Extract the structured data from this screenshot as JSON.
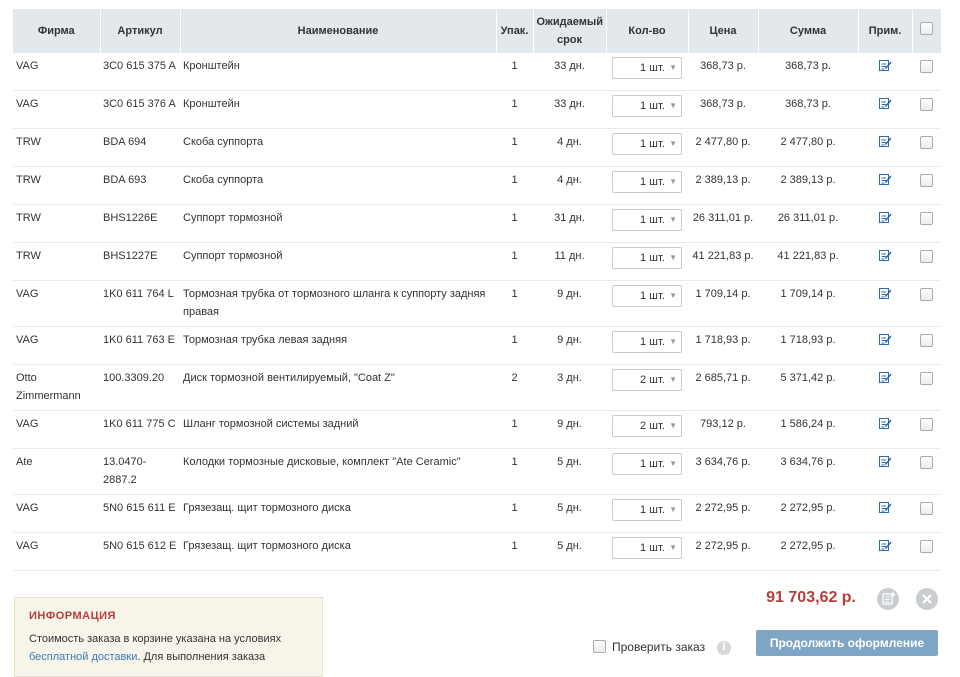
{
  "columns": {
    "firm": "Фирма",
    "article": "Артикул",
    "name": "Наименование",
    "pack": "Упак.",
    "term_line1": "Ожидаемый",
    "term_line2": "срок",
    "qty": "Кол-во",
    "price": "Цена",
    "sum": "Сумма",
    "note": "Прим."
  },
  "rows": [
    {
      "firm": "VAG",
      "article": "3C0 615 375 A",
      "name": "Кронштейн",
      "pack": "1",
      "term": "33 дн.",
      "qty": "1 шт.",
      "price": "368,73 р.",
      "sum": "368,73 р."
    },
    {
      "firm": "VAG",
      "article": "3C0 615 376 A",
      "name": "Кронштейн",
      "pack": "1",
      "term": "33 дн.",
      "qty": "1 шт.",
      "price": "368,73 р.",
      "sum": "368,73 р."
    },
    {
      "firm": "TRW",
      "article": "BDA 694",
      "name": "Скоба суппорта",
      "pack": "1",
      "term": "4 дн.",
      "qty": "1 шт.",
      "price": "2 477,80 р.",
      "sum": "2 477,80 р."
    },
    {
      "firm": "TRW",
      "article": "BDA 693",
      "name": "Скоба суппорта",
      "pack": "1",
      "term": "4 дн.",
      "qty": "1 шт.",
      "price": "2 389,13 р.",
      "sum": "2 389,13 р."
    },
    {
      "firm": "TRW",
      "article": "BHS1226E",
      "name": "Суппорт тормозной",
      "pack": "1",
      "term": "31 дн.",
      "qty": "1 шт.",
      "price": "26 311,01 р.",
      "sum": "26 311,01 р."
    },
    {
      "firm": "TRW",
      "article": "BHS1227E",
      "name": "Суппорт тормозной",
      "pack": "1",
      "term": "11 дн.",
      "qty": "1 шт.",
      "price": "41 221,83 р.",
      "sum": "41 221,83 р."
    },
    {
      "firm": "VAG",
      "article": "1K0 611 764 L",
      "name": "Тормозная трубка от тормозного шланга к суппорту задняя правая",
      "pack": "1",
      "term": "9 дн.",
      "qty": "1 шт.",
      "price": "1 709,14 р.",
      "sum": "1 709,14 р."
    },
    {
      "firm": "VAG",
      "article": "1K0 611 763 E",
      "name": "Тормозная трубка левая задняя",
      "pack": "1",
      "term": "9 дн.",
      "qty": "1 шт.",
      "price": "1 718,93 р.",
      "sum": "1 718,93 р."
    },
    {
      "firm": "Otto Zimmermann",
      "article": "100.3309.20",
      "name": "Диск тормозной вентилируемый, \"Coat Z\"",
      "pack": "2",
      "term": "3 дн.",
      "qty": "2 шт.",
      "price": "2 685,71 р.",
      "sum": "5 371,42 р."
    },
    {
      "firm": "VAG",
      "article": "1K0 611 775 C",
      "name": "Шланг тормозной системы задний",
      "pack": "1",
      "term": "9 дн.",
      "qty": "2 шт.",
      "price": "793,12 р.",
      "sum": "1 586,24 р."
    },
    {
      "firm": "Ate",
      "article": "13.0470-2887.2",
      "name": "Колодки тормозные дисковые, комплект \"Ate Ceramic\"",
      "pack": "1",
      "term": "5 дн.",
      "qty": "1 шт.",
      "price": "3 634,76 р.",
      "sum": "3 634,76 р."
    },
    {
      "firm": "VAG",
      "article": "5N0 615 611 E",
      "name": "Грязезащ. щит тормозного диска",
      "pack": "1",
      "term": "5 дн.",
      "qty": "1 шт.",
      "price": "2 272,95 р.",
      "sum": "2 272,95 р."
    },
    {
      "firm": "VAG",
      "article": "5N0 615 612 E",
      "name": "Грязезащ. щит тормозного диска",
      "pack": "1",
      "term": "5 дн.",
      "qty": "1 шт.",
      "price": "2 272,95 р.",
      "sum": "2 272,95 р."
    }
  ],
  "summary": {
    "total": "91 703,62 р."
  },
  "info": {
    "title": "ИНФОРМАЦИЯ",
    "text_before": "Стоимость заказа в корзине указана на условиях ",
    "link": "бесплатной доставки",
    "text_after": ". Для выполнения заказа"
  },
  "actions": {
    "verify_label": "Проверить заказ",
    "info_glyph": "i",
    "continue_label": "Продолжить оформление"
  },
  "icons": {
    "note": "edit-note-icon",
    "add": "add-to-list-icon",
    "clear": "close-icon",
    "qty_arrow": "▼"
  },
  "colors": {
    "header_bg": "#e3e8ec",
    "total": "#b5403a",
    "info_title": "#b5403a",
    "link": "#3a79b8",
    "button": "#7fa5c4",
    "info_bg": "#f7f5ea"
  }
}
